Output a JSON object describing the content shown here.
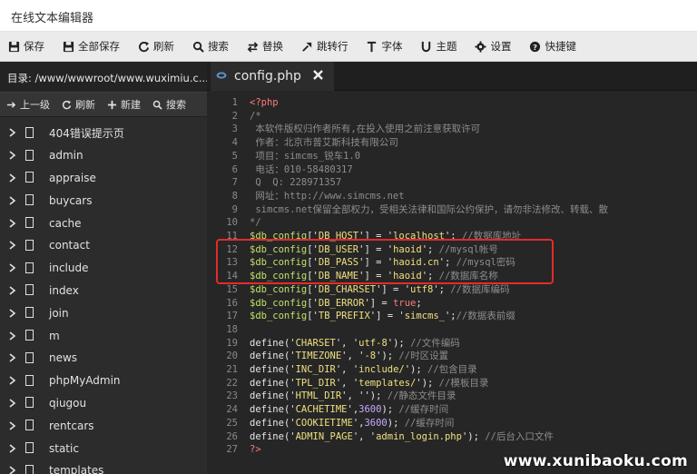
{
  "window": {
    "title": "在线文本编辑器"
  },
  "toolbar": {
    "buttons": [
      {
        "label": "保存",
        "icon": "save-icon"
      },
      {
        "label": "全部保存",
        "icon": "save-all-icon"
      },
      {
        "label": "刷新",
        "icon": "refresh-icon"
      },
      {
        "label": "搜索",
        "icon": "search-icon"
      },
      {
        "label": "替换",
        "icon": "replace-icon"
      },
      {
        "label": "跳转行",
        "icon": "goto-line-icon"
      },
      {
        "label": "字体",
        "icon": "font-icon"
      },
      {
        "label": "主题",
        "icon": "theme-icon"
      },
      {
        "label": "设置",
        "icon": "gear-icon"
      },
      {
        "label": "快捷键",
        "icon": "help-icon"
      }
    ]
  },
  "sidebar": {
    "path": "目录: /www/wwwroot/www.wuximiu.c...",
    "actions": [
      {
        "label": "上一级",
        "icon": "up-level-icon"
      },
      {
        "label": "刷新",
        "icon": "refresh-icon"
      },
      {
        "label": "新建",
        "icon": "plus-icon"
      },
      {
        "label": "搜索",
        "icon": "search-icon"
      }
    ],
    "items": [
      {
        "label": "404错误提示页"
      },
      {
        "label": "admin"
      },
      {
        "label": "appraise"
      },
      {
        "label": "buycars"
      },
      {
        "label": "cache"
      },
      {
        "label": "contact"
      },
      {
        "label": "include"
      },
      {
        "label": "index"
      },
      {
        "label": "join"
      },
      {
        "label": "m"
      },
      {
        "label": "news"
      },
      {
        "label": "phpMyAdmin"
      },
      {
        "label": "qiugou"
      },
      {
        "label": "rentcars"
      },
      {
        "label": "static"
      },
      {
        "label": "templates"
      }
    ]
  },
  "editor": {
    "tab": {
      "name": "config.php"
    },
    "line_numbers": [
      "1",
      "2",
      "3",
      "4",
      "5",
      "6",
      "7",
      "8",
      "9",
      "10",
      "11",
      "12",
      "13",
      "14",
      "15",
      "16",
      "17",
      "18",
      "19",
      "20",
      "21",
      "22",
      "23",
      "24",
      "25",
      "26",
      "27"
    ],
    "lines": [
      [
        [
          "kw",
          "<?php"
        ]
      ],
      [
        [
          "cm",
          "/*"
        ]
      ],
      [
        [
          "cm",
          " 本软件版权归作者所有,在投入使用之前注意获取许可"
        ]
      ],
      [
        [
          "cm",
          " 作者：北京市普艾斯科技有限公司"
        ]
      ],
      [
        [
          "cm",
          " 项目：simcms_锐车1.0"
        ]
      ],
      [
        [
          "cm",
          " 电话：010-58480317"
        ]
      ],
      [
        [
          "cm",
          " Q  Q: 228971357"
        ]
      ],
      [
        [
          "cm",
          " 网址：http://www.simcms.net"
        ]
      ],
      [
        [
          "cm",
          " simcms.net保留全部权力，受相关法律和国际公约保护，请勿非法修改、转载、散"
        ]
      ],
      [
        [
          "cm",
          "*/"
        ]
      ],
      [
        [
          "var",
          "$db_config"
        ],
        [
          "pun",
          "['"
        ],
        [
          "str",
          "DB_HOST"
        ],
        [
          "pun",
          "'] = '"
        ],
        [
          "str",
          "localhost"
        ],
        [
          "pun",
          "'; "
        ],
        [
          "cm",
          "//数据库地址"
        ]
      ],
      [
        [
          "var",
          "$db_config"
        ],
        [
          "pun",
          "['"
        ],
        [
          "str",
          "DB_USER"
        ],
        [
          "pun",
          "'] = '"
        ],
        [
          "str",
          "haoid"
        ],
        [
          "pun",
          "'; "
        ],
        [
          "cm",
          "//mysql帐号"
        ]
      ],
      [
        [
          "var",
          "$db_config"
        ],
        [
          "pun",
          "['"
        ],
        [
          "str",
          "DB_PASS"
        ],
        [
          "pun",
          "'] = '"
        ],
        [
          "str",
          "haoid.cn"
        ],
        [
          "pun",
          "'; "
        ],
        [
          "cm",
          "//mysql密码"
        ]
      ],
      [
        [
          "var",
          "$db_config"
        ],
        [
          "pun",
          "['"
        ],
        [
          "str",
          "DB_NAME"
        ],
        [
          "pun",
          "'] = '"
        ],
        [
          "str",
          "haoid"
        ],
        [
          "pun",
          "'; "
        ],
        [
          "cm",
          "//数据库名称"
        ]
      ],
      [
        [
          "var",
          "$db_config"
        ],
        [
          "pun",
          "['"
        ],
        [
          "str",
          "DB_CHARSET"
        ],
        [
          "pun",
          "'] = '"
        ],
        [
          "str",
          "utf8"
        ],
        [
          "pun",
          "'; "
        ],
        [
          "cm",
          "//数据库编码"
        ]
      ],
      [
        [
          "var",
          "$db_config"
        ],
        [
          "pun",
          "['"
        ],
        [
          "str",
          "DB_ERROR"
        ],
        [
          "pun",
          "'] = "
        ],
        [
          "kw",
          "true"
        ],
        [
          "pun",
          ";"
        ]
      ],
      [
        [
          "var",
          "$db_config"
        ],
        [
          "pun",
          "['"
        ],
        [
          "str",
          "TB_PREFIX"
        ],
        [
          "pun",
          "'] = '"
        ],
        [
          "str",
          "simcms_"
        ],
        [
          "pun",
          "';"
        ],
        [
          "cm",
          "//数据表前缀"
        ]
      ],
      [
        [
          "pun",
          ""
        ]
      ],
      [
        [
          "fn",
          "define"
        ],
        [
          "pun",
          "('"
        ],
        [
          "str",
          "CHARSET"
        ],
        [
          "pun",
          "', '"
        ],
        [
          "str",
          "utf-8"
        ],
        [
          "pun",
          "'); "
        ],
        [
          "cm",
          "//文件编码"
        ]
      ],
      [
        [
          "fn",
          "define"
        ],
        [
          "pun",
          "('"
        ],
        [
          "str",
          "TIMEZONE"
        ],
        [
          "pun",
          "', '"
        ],
        [
          "str",
          "-8"
        ],
        [
          "pun",
          "'); "
        ],
        [
          "cm",
          "//时区设置"
        ]
      ],
      [
        [
          "fn",
          "define"
        ],
        [
          "pun",
          "('"
        ],
        [
          "str",
          "INC_DIR"
        ],
        [
          "pun",
          "', '"
        ],
        [
          "str",
          "include/"
        ],
        [
          "pun",
          "'); "
        ],
        [
          "cm",
          "//包含目录"
        ]
      ],
      [
        [
          "fn",
          "define"
        ],
        [
          "pun",
          "('"
        ],
        [
          "str",
          "TPL_DIR"
        ],
        [
          "pun",
          "', '"
        ],
        [
          "str",
          "templates/"
        ],
        [
          "pun",
          "'); "
        ],
        [
          "cm",
          "//模板目录"
        ]
      ],
      [
        [
          "fn",
          "define"
        ],
        [
          "pun",
          "('"
        ],
        [
          "str",
          "HTML_DIR"
        ],
        [
          "pun",
          "', ''); "
        ],
        [
          "cm",
          "//静态文件目录"
        ]
      ],
      [
        [
          "fn",
          "define"
        ],
        [
          "pun",
          "('"
        ],
        [
          "str",
          "CACHETIME"
        ],
        [
          "pun",
          "',"
        ],
        [
          "num",
          "3600"
        ],
        [
          "pun",
          "); "
        ],
        [
          "cm",
          "//缓存时间"
        ]
      ],
      [
        [
          "fn",
          "define"
        ],
        [
          "pun",
          "('"
        ],
        [
          "str",
          "COOKIETIME"
        ],
        [
          "pun",
          "',"
        ],
        [
          "num",
          "3600"
        ],
        [
          "pun",
          "); "
        ],
        [
          "cm",
          "//缓存时间"
        ]
      ],
      [
        [
          "fn",
          "define"
        ],
        [
          "pun",
          "('"
        ],
        [
          "str",
          "ADMIN_PAGE"
        ],
        [
          "pun",
          "', '"
        ],
        [
          "str",
          "admin_login.php"
        ],
        [
          "pun",
          "'); "
        ],
        [
          "cm",
          "//后台入口文件"
        ]
      ],
      [
        [
          "kw",
          "?>"
        ]
      ]
    ]
  },
  "watermark": "www.xunibaoku.com"
}
